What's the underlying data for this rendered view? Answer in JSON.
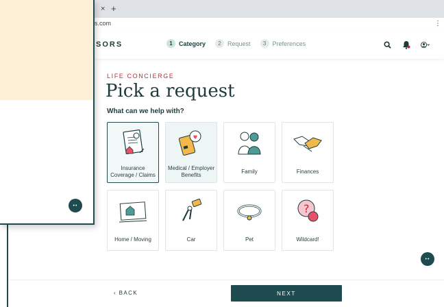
{
  "browser": {
    "tab_close": "×",
    "tab_new": "+",
    "url": "s.com",
    "menu": "⋮"
  },
  "header": {
    "brand": "SORS",
    "steps": [
      {
        "num": "1",
        "label": "Category",
        "active": true
      },
      {
        "num": "2",
        "label": "Request",
        "active": false
      },
      {
        "num": "3",
        "label": "Preferences",
        "active": false
      }
    ],
    "icons": [
      "search-icon",
      "bell-icon",
      "account-icon"
    ]
  },
  "main": {
    "eyebrow": "LIFE CONCIERGE",
    "title": "Pick a request",
    "prompt": "What can we help with?",
    "categories": [
      {
        "label": "Insurance Coverage / Claims",
        "icon": "insurance-document-icon",
        "selected": true
      },
      {
        "label": "Medical / Employer Benefits",
        "icon": "medical-card-icon",
        "selected": false
      },
      {
        "label": "Family",
        "icon": "family-icon",
        "selected": false
      },
      {
        "label": "Finances",
        "icon": "handshake-icon",
        "selected": false
      },
      {
        "label": "Home / Moving",
        "icon": "house-sign-icon",
        "selected": false
      },
      {
        "label": "Car",
        "icon": "car-keys-icon",
        "selected": false
      },
      {
        "label": "Pet",
        "icon": "pet-collar-icon",
        "selected": false
      },
      {
        "label": "Wildcard!",
        "icon": "question-bubble-icon",
        "selected": false
      }
    ]
  },
  "footer": {
    "back": "‹ BACK",
    "next": "NEXT"
  },
  "chat": {
    "label": "••"
  },
  "colors": {
    "primary": "#1d4b4f",
    "accent": "#c5273b",
    "hero": "#fdf0d7"
  }
}
